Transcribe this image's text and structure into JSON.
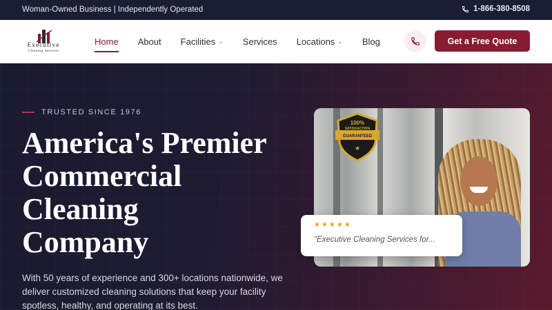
{
  "topbar": {
    "tagline": "Woman-Owned Business | Independently Operated",
    "phone": "1-866-380-8508"
  },
  "logo": {
    "name": "Executive",
    "subtitle": "Cleaning Services"
  },
  "nav": {
    "items": [
      {
        "label": "Home",
        "active": true,
        "dropdown": false
      },
      {
        "label": "About",
        "active": false,
        "dropdown": false
      },
      {
        "label": "Facilities",
        "active": false,
        "dropdown": true
      },
      {
        "label": "Services",
        "active": false,
        "dropdown": false
      },
      {
        "label": "Locations",
        "active": false,
        "dropdown": true
      },
      {
        "label": "Blog",
        "active": false,
        "dropdown": false
      }
    ],
    "cta_label": "Get a Free Quote"
  },
  "hero": {
    "eyebrow": "TRUSTED SINCE 1976",
    "headline_lines": [
      "America's Premier",
      "Commercial",
      "Cleaning",
      "Company"
    ],
    "description": "With 50 years of experience and 300+ locations nationwide, we deliver customized cleaning solutions that keep your facility spotless, healthy, and operating at its best.",
    "badge": {
      "line1": "100%",
      "line2": "SATISFACTION",
      "line3": "GUARANTEED"
    },
    "review": {
      "stars": "★★★★★",
      "quote": "\"Executive Cleaning Services for..."
    }
  },
  "colors": {
    "brand": "#8a1c32",
    "topbar_bg": "#1b1e33",
    "star": "#e3a21a"
  },
  "icons": [
    "phone-icon",
    "chevron-down-icon",
    "star-icon",
    "logo-building-icon"
  ]
}
